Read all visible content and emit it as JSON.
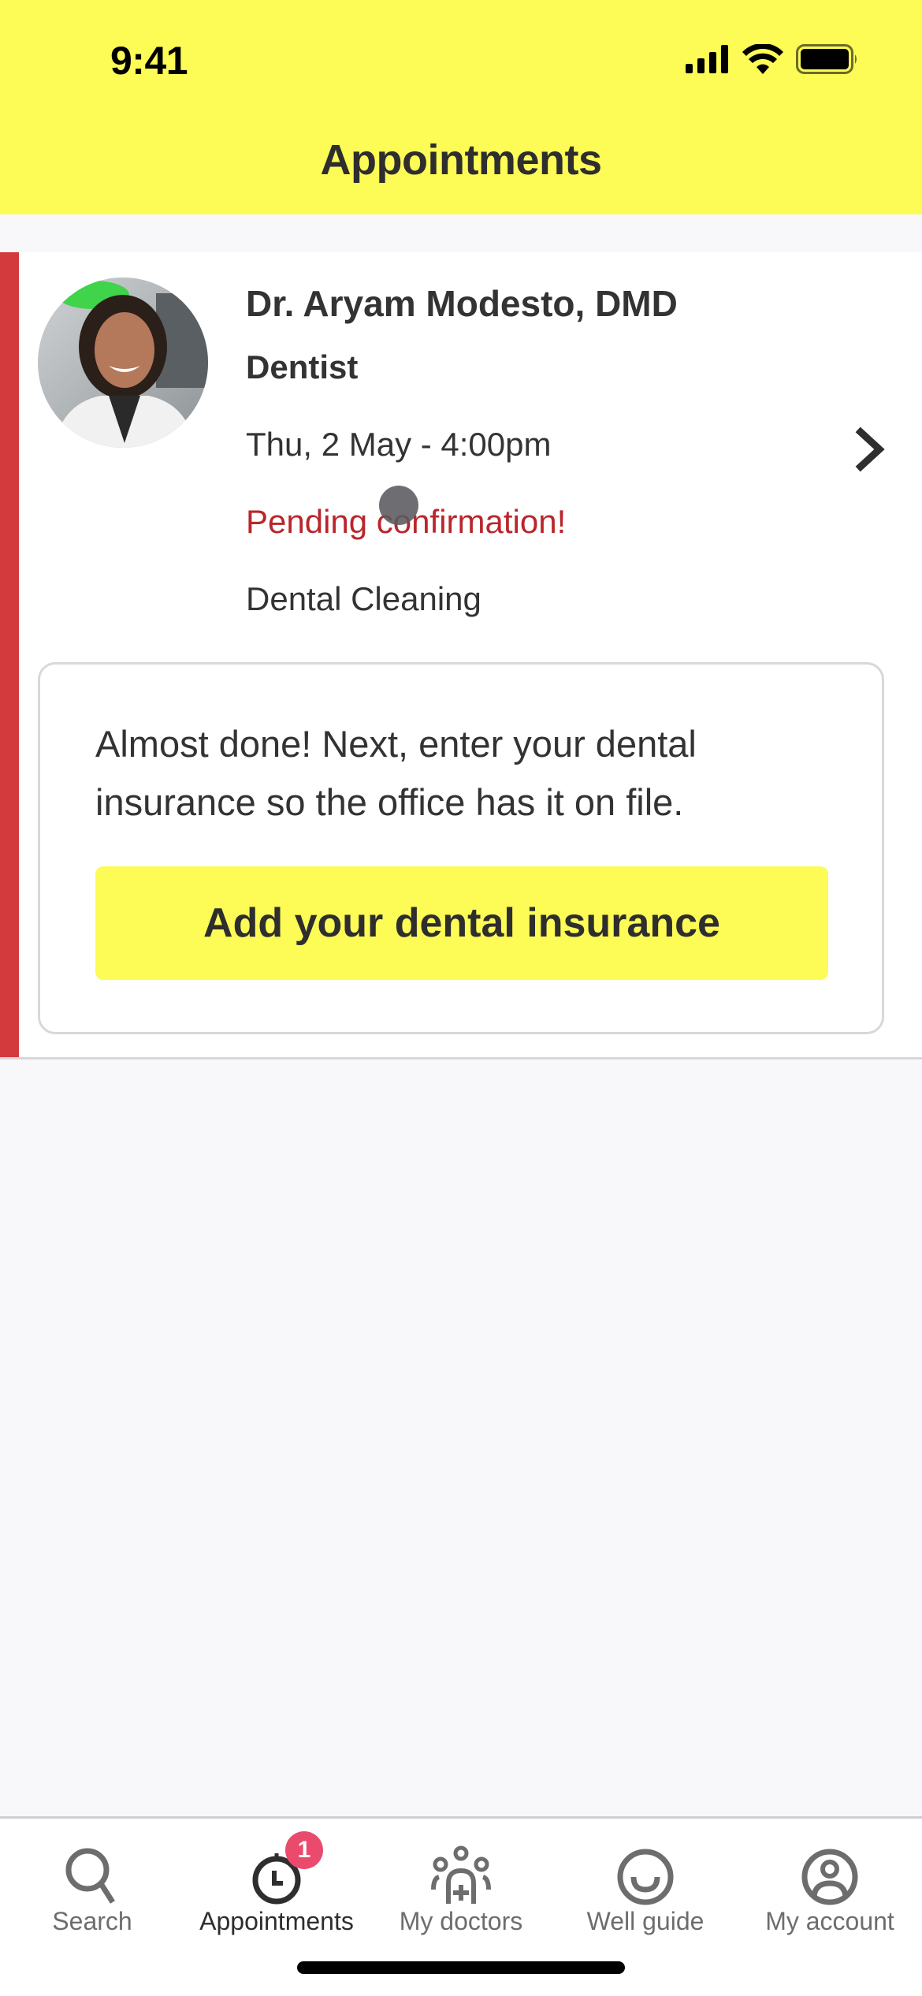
{
  "status_bar": {
    "time": "9:41",
    "icons": [
      "cellular-signal-icon",
      "wifi-icon",
      "battery-icon"
    ]
  },
  "header": {
    "title": "Appointments"
  },
  "appointment": {
    "doctor_name": "Dr. Aryam Modesto, DMD",
    "specialty": "Dentist",
    "datetime": "Thu, 2 May - 4:00pm",
    "status": "Pending confirmation!",
    "service": "Dental Cleaning",
    "avatar": "doctor-photo",
    "accent_color": "#d33a3d",
    "status_color": "#b8262c"
  },
  "insurance_prompt": {
    "message": "Almost done! Next, enter your dental insurance so the office has it on file.",
    "button_label": "Add your dental insurance"
  },
  "tabbar": {
    "items": [
      {
        "label": "Search",
        "icon": "search-icon",
        "active": false
      },
      {
        "label": "Appointments",
        "icon": "clock-icon",
        "active": true,
        "badge": "1"
      },
      {
        "label": "My doctors",
        "icon": "doctors-group-icon",
        "active": false
      },
      {
        "label": "Well guide",
        "icon": "smile-icon",
        "active": false
      },
      {
        "label": "My account",
        "icon": "user-circle-icon",
        "active": false
      }
    ]
  },
  "colors": {
    "brand_yellow": "#fdfb55",
    "badge_pink": "#ea4b6c"
  }
}
